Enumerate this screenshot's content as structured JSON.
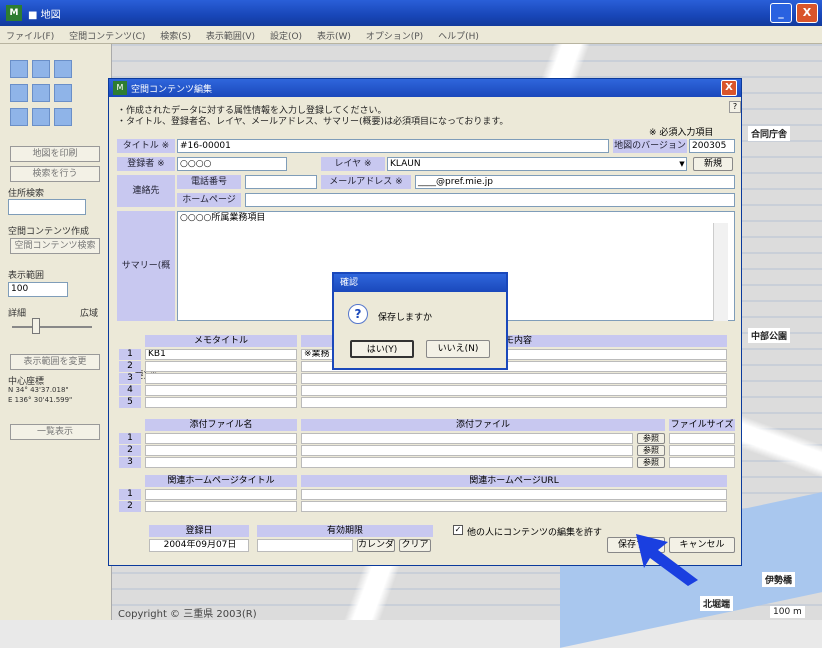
{
  "main_window": {
    "title": "■ 地図",
    "menu": [
      "ファイル(F)",
      "空間コンテンツ(C)",
      "検索(S)",
      "表示範囲(V)",
      "設定(O)",
      "表示(W)",
      "オプション(P)",
      "ヘルプ(H)"
    ],
    "minimize_label": "_",
    "close_label": "X",
    "copyright": "Copyright © 三重県 2003(R)"
  },
  "left_panel": {
    "buttons": [
      "地図を印刷",
      "検索を行う",
      "空間コンテンツ検索",
      "表示範囲を変更",
      "一覧表示"
    ],
    "address_search_label": "住所検索",
    "content_create_label": "空間コンテンツ作成",
    "display_range_label": "表示範囲",
    "scale_value": "100",
    "scale_left": "詳細",
    "scale_right": "広域",
    "center_coord_label": "中心座標",
    "lat": "N  34°  43'37.018\"",
    "lon": "E 136°  30'41.599\""
  },
  "map_labels": [
    "合同庁舎",
    "中部公園",
    "伊勢橋",
    "北堀端",
    "100 m"
  ],
  "dialog": {
    "title": "空間コンテンツ編集",
    "help_label": "?",
    "close_label": "X",
    "intro_line1": "・作成されたデータに対する属性情報を入力し登録してください。",
    "intro_line2": "・タイトル、登録者名、レイヤ、メールアドレス、サマリー(概要)は必須項目になっております。",
    "required_note": "※ 必須入力項目",
    "title_label": "タイトル ※",
    "title_value": "#16-00001",
    "map_version_label": "地図のバージョン",
    "map_version_value": "200305",
    "registrant_label": "登録者 ※",
    "registrant_value": "○○○○",
    "layer_label": "レイヤ ※",
    "layer_value": "KLAUN",
    "new_button": "新規",
    "contact_label": "連絡先",
    "phone_label": "電話番号",
    "phone_value": "",
    "email_label": "メールアドレス ※",
    "email_value": "____@pref.mie.jp",
    "homepage_label": "ホームページ",
    "homepage_value": "",
    "summary_label": "サマリー(概要) ※",
    "summary_value": "○○○○所属業務項目",
    "memo_header_title": "メモタイトル",
    "memo_header_content": "メモ内容",
    "memo_rows": [
      {
        "no": "1",
        "title": "KB1",
        "content": "※業務"
      },
      {
        "no": "2",
        "title": "",
        "content": ""
      },
      {
        "no": "3",
        "title": "",
        "content": ""
      },
      {
        "no": "4",
        "title": "",
        "content": ""
      },
      {
        "no": "5",
        "title": "",
        "content": ""
      }
    ],
    "attach_header_name": "添付ファイル名",
    "attach_header_file": "添付ファイル",
    "attach_header_size": "ファイルサイズ",
    "attach_rows": [
      {
        "no": "1",
        "name": "",
        "file": "",
        "size": "",
        "browse": "参照"
      },
      {
        "no": "2",
        "name": "",
        "file": "",
        "size": "",
        "browse": "参照"
      },
      {
        "no": "3",
        "name": "",
        "file": "",
        "size": "",
        "browse": "参照"
      }
    ],
    "link_header_title": "関連ホームページタイトル",
    "link_header_url": "関連ホームページURL",
    "link_rows": [
      {
        "no": "1",
        "title": "",
        "url": ""
      },
      {
        "no": "2",
        "title": "",
        "url": ""
      }
    ],
    "reg_date_label": "登録日",
    "reg_date_value": "2004年09月07日",
    "expiry_label": "有効期限",
    "calendar_button": "カレンダ",
    "clear_button": "クリア",
    "allow_edit_label": "他の人にコンテンツの編集を許す",
    "allow_edit_checked": true,
    "save_button": "保存する",
    "cancel_button": "キャンセル"
  },
  "confirm": {
    "title": "確認",
    "message": "保存しますか",
    "yes_button": "はい(Y)",
    "no_button": "いいえ(N)"
  },
  "colors": {
    "titlebar": "#1a48bb",
    "label_bg": "#c8c8f0",
    "arrow": "#1a3fe0"
  }
}
